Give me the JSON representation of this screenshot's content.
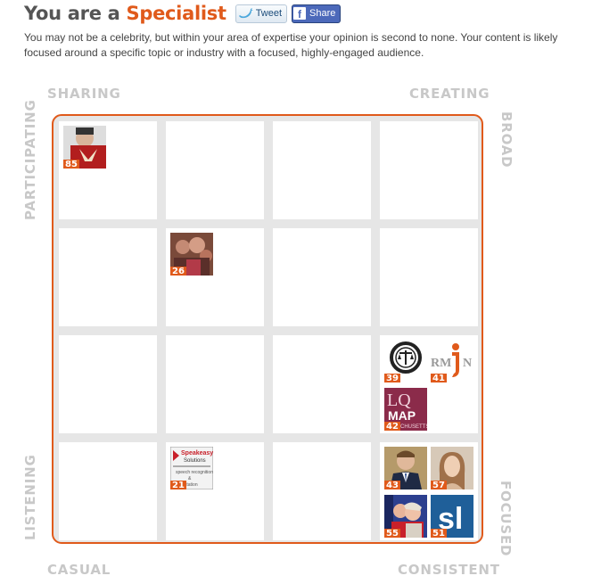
{
  "header": {
    "title_prefix": "You are a",
    "title_type": "Specialist",
    "tweet_label": "Tweet",
    "share_label": "Share",
    "share_icon_glyph": "f",
    "description": "You may not be a celebrity, but within your area of expertise your opinion is second to none. Your content is likely focused around a specific topic or industry with a focused, highly-engaged audience."
  },
  "matrix": {
    "labels": {
      "top_left": "SHARING",
      "top_right": "CREATING",
      "bottom_left": "CASUAL",
      "bottom_right": "CONSISTENT",
      "left_top": "PARTICIPATING",
      "left_bottom": "LISTENING",
      "right_top": "BROAD",
      "right_bottom": "FOCUSED"
    },
    "accent_color": "#e05a1b",
    "influencers": [
      {
        "score": "85",
        "row": 0,
        "col": 0,
        "icon": "person-butterfly-avatar"
      },
      {
        "score": "26",
        "row": 1,
        "col": 1,
        "icon": "group-photo-avatar"
      },
      {
        "score": "39",
        "row": 2,
        "col": 3,
        "icon": "scales-seal-avatar"
      },
      {
        "score": "41",
        "row": 2,
        "col": 3,
        "icon": "letter-i-logo-avatar",
        "logo_text": "RM  N"
      },
      {
        "score": "42",
        "row": 2,
        "col": 3,
        "icon": "lq-map-logo-avatar",
        "logo_text": "LQ MAP",
        "logo_subtext": "ACHUSETTS"
      },
      {
        "score": "21",
        "row": 3,
        "col": 1,
        "icon": "speakeasy-logo-avatar",
        "logo_text": "Speakeasy Solutions",
        "logo_subtext": "speech recognition & dictation"
      },
      {
        "score": "43",
        "row": 3,
        "col": 3,
        "icon": "man-in-suit-avatar"
      },
      {
        "score": "57",
        "row": 3,
        "col": 3,
        "icon": "woman-portrait-avatar"
      },
      {
        "score": "55",
        "row": 3,
        "col": 3,
        "icon": "couple-photo-avatar"
      },
      {
        "score": "51",
        "row": 3,
        "col": 3,
        "icon": "sl-logo-avatar",
        "logo_text": "sl"
      }
    ]
  }
}
